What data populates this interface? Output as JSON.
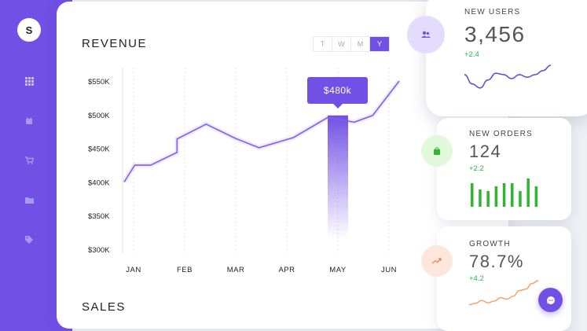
{
  "sidebar": {
    "logo_letter": "S",
    "items": [
      {
        "icon": "grid-icon"
      },
      {
        "icon": "calendar-icon"
      },
      {
        "icon": "cart-icon"
      },
      {
        "icon": "folder-icon"
      },
      {
        "icon": "tag-icon"
      }
    ],
    "icon_color": "#b8a8f5"
  },
  "revenue": {
    "title": "REVENUE",
    "range_tabs": [
      "T",
      "W",
      "M",
      "Y"
    ],
    "active_range": "Y",
    "tooltip": "$480k"
  },
  "sales": {
    "title": "SALES"
  },
  "cards": {
    "new_users": {
      "label": "NEW USERS",
      "value": "3,456",
      "change": "+2.4"
    },
    "new_orders": {
      "label": "NEW ORDERS",
      "value": "124",
      "change": "+2.2"
    },
    "growth": {
      "label": "GROWTH",
      "value": "78.7%",
      "change": "+4.2"
    }
  },
  "colors": {
    "accent": "#7150e6",
    "positive": "#27b54a",
    "orders_bar": "#2fb52f",
    "growth_line": "#f0a060"
  },
  "chart_data": {
    "type": "line",
    "title": "REVENUE",
    "categories": [
      "JAN",
      "FEB",
      "MAR",
      "APR",
      "MAY",
      "JUN"
    ],
    "y_ticks": [
      "$550K",
      "$500K",
      "$450K",
      "$400K",
      "$350K",
      "$300K"
    ],
    "ylim": [
      300,
      550
    ],
    "grid": true,
    "series": [
      {
        "x": [
          0,
          0.2,
          0.5,
          1.0,
          1.0,
          1.55,
          2.1,
          2.55,
          3.2,
          3.85,
          4.35,
          4.7,
          5.2
        ],
        "values": [
          401,
          426,
          426,
          445,
          465,
          487,
          466,
          452,
          467,
          497,
          490,
          500,
          551
        ]
      }
    ],
    "highlight": {
      "category": "MAY",
      "value": 500,
      "label": "$480k"
    }
  },
  "mini_charts": {
    "orders_bars": [
      30,
      22,
      20,
      26,
      30,
      30,
      20,
      36,
      26
    ],
    "users_line": [
      0.35,
      0.7,
      0.85,
      0.55,
      0.3,
      0.35,
      0.5,
      0.35,
      0.45,
      0.35,
      0.2,
      0.0
    ],
    "growth_line": [
      0.85,
      0.8,
      0.7,
      0.78,
      0.72,
      0.6,
      0.65,
      0.55,
      0.35,
      0.3,
      0.1,
      0.0
    ]
  }
}
